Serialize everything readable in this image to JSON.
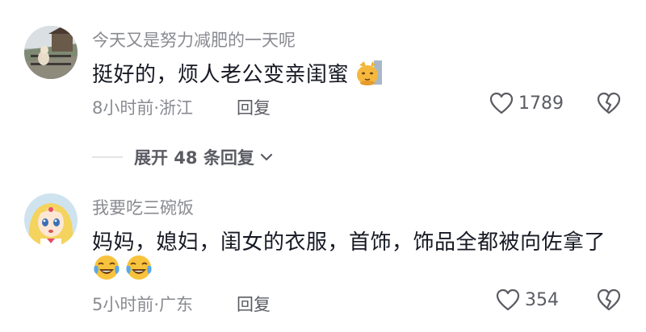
{
  "comments": [
    {
      "username": "今天又是努力减肥的一天呢",
      "text": "挺好的，烦人老公变亲闺蜜",
      "meta": "8小时前·浙江",
      "reply_label": "回复",
      "likes": "1789",
      "emoji": "cat-face"
    },
    {
      "username": "我要吃三碗饭",
      "text": "妈妈，媳妇，闺女的衣服，首饰，饰品全都被向佐拿了",
      "meta": "5小时前·广东",
      "reply_label": "回复",
      "likes": "354",
      "emoji": "crying-laughing-face"
    }
  ],
  "expand_replies": "展开 48 条回复"
}
